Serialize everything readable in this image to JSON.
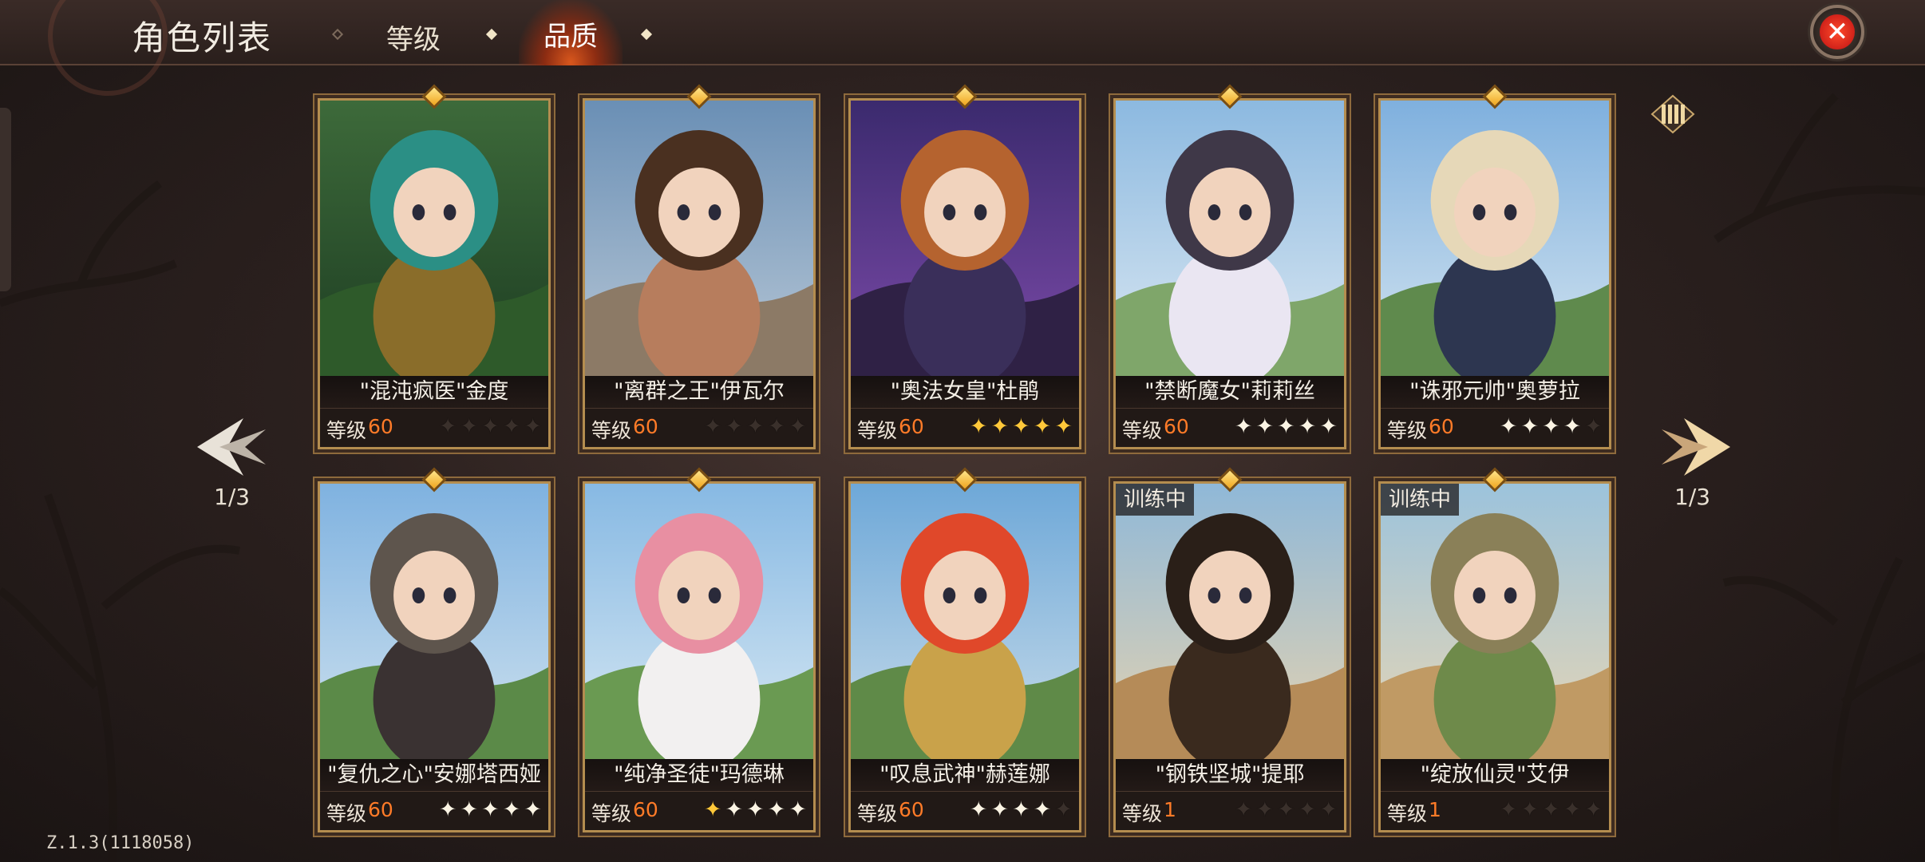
{
  "header": {
    "title": "角色列表",
    "tabs": [
      {
        "label": "等级",
        "active": false
      },
      {
        "label": "品质",
        "active": true
      }
    ],
    "close_icon": "close-x-icon"
  },
  "navigation": {
    "left_page": "1/3",
    "right_page": "1/3"
  },
  "level_label": "等级",
  "colors": {
    "accent_orange": "#ff7b28",
    "card_border": "#b48d4f",
    "close_red": "#d1221a",
    "star_gold": "#ffc83a"
  },
  "cards": [
    {
      "name": "\"混沌疯医\"金度",
      "level": "60",
      "stars": 0,
      "gold_stars": 0,
      "max_stars": 5,
      "training": ""
    },
    {
      "name": "\"离群之王\"伊瓦尔",
      "level": "60",
      "stars": 0,
      "gold_stars": 0,
      "max_stars": 5,
      "training": ""
    },
    {
      "name": "\"奥法女皇\"杜鹃",
      "level": "60",
      "stars": 5,
      "gold_stars": 5,
      "max_stars": 5,
      "training": ""
    },
    {
      "name": "\"禁断魔女\"莉莉丝",
      "level": "60",
      "stars": 5,
      "gold_stars": 0,
      "max_stars": 5,
      "training": ""
    },
    {
      "name": "\"诛邪元帅\"奥萝拉",
      "level": "60",
      "stars": 4,
      "gold_stars": 0,
      "max_stars": 5,
      "training": ""
    },
    {
      "name": "\"复仇之心\"安娜塔西娅",
      "level": "60",
      "stars": 5,
      "gold_stars": 0,
      "max_stars": 5,
      "training": ""
    },
    {
      "name": "\"纯净圣徒\"玛德琳",
      "level": "60",
      "stars": 5,
      "gold_stars": 1,
      "max_stars": 5,
      "training": ""
    },
    {
      "name": "\"叹息武神\"赫莲娜",
      "level": "60",
      "stars": 4,
      "gold_stars": 0,
      "max_stars": 5,
      "training": ""
    },
    {
      "name": "\"钢铁坚城\"提耶",
      "level": "1",
      "stars": 0,
      "gold_stars": 0,
      "max_stars": 5,
      "training": "训练中"
    },
    {
      "name": "\"绽放仙灵\"艾伊",
      "level": "1",
      "stars": 0,
      "gold_stars": 0,
      "max_stars": 5,
      "training": "训练中"
    }
  ],
  "footer": {
    "version": "Z.1.3(1118058)"
  }
}
